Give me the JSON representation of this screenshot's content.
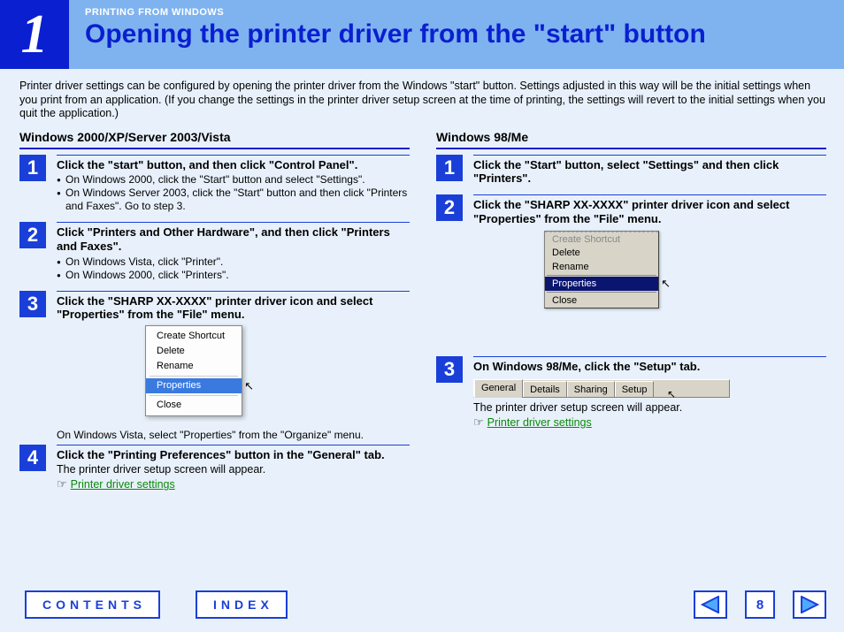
{
  "header": {
    "chapter_num": "1",
    "kicker": "PRINTING FROM WINDOWS",
    "title": "Opening the printer driver from the \"start\" button"
  },
  "intro": "Printer driver settings can be configured by opening the printer driver from the Windows \"start\" button. Settings adjusted in this way will be the initial settings when you print from an application. (If you change the settings in the printer driver setup screen at the time of printing, the settings will revert to the initial settings when you quit the application.)",
  "left": {
    "heading": "Windows 2000/XP/Server 2003/Vista",
    "steps": [
      {
        "n": "1",
        "main": "Click the \"start\" button, and then click \"Control Panel\".",
        "bullets": [
          "On Windows 2000, click the \"Start\" button and select \"Settings\".",
          "On Windows Server 2003, click the \"Start\" button and then click \"Printers and Faxes\". Go to step 3."
        ]
      },
      {
        "n": "2",
        "main": "Click \"Printers and Other Hardware\", and then click \"Printers and Faxes\".",
        "bullets": [
          "On Windows Vista, click \"Printer\".",
          "On Windows 2000, click \"Printers\"."
        ]
      },
      {
        "n": "3",
        "main": "Click the \"SHARP XX-XXXX\" printer driver icon and select \"Properties\" from the \"File\" menu.",
        "menu": [
          "Create Shortcut",
          "Delete",
          "Rename",
          "Properties",
          "Close"
        ],
        "hl": "Properties",
        "after_note": "On Windows Vista, select \"Properties\" from the \"Organize\" menu."
      },
      {
        "n": "4",
        "main": "Click the \"Printing Preferences\" button in the \"General\" tab.",
        "sub": "The printer driver setup screen will appear.",
        "link": "Printer driver settings"
      }
    ]
  },
  "right": {
    "heading": "Windows 98/Me",
    "steps": [
      {
        "n": "1",
        "main": "Click the \"Start\" button, select \"Settings\" and then click \"Printers\"."
      },
      {
        "n": "2",
        "main": "Click the \"SHARP XX-XXXX\" printer driver icon and select \"Properties\" from the \"File\" menu.",
        "menu": [
          "Create Shortcut",
          "Delete",
          "Rename",
          "Properties",
          "Close"
        ],
        "hl": "Properties"
      },
      {
        "n": "3",
        "main": "On Windows 98/Me, click the \"Setup\" tab.",
        "tabs": [
          "General",
          "Details",
          "Sharing",
          "Setup"
        ],
        "sub": "The printer driver setup screen will appear.",
        "link": "Printer driver settings"
      }
    ]
  },
  "nav": {
    "contents": "CONTENTS",
    "index": "INDEX",
    "page": "8"
  }
}
